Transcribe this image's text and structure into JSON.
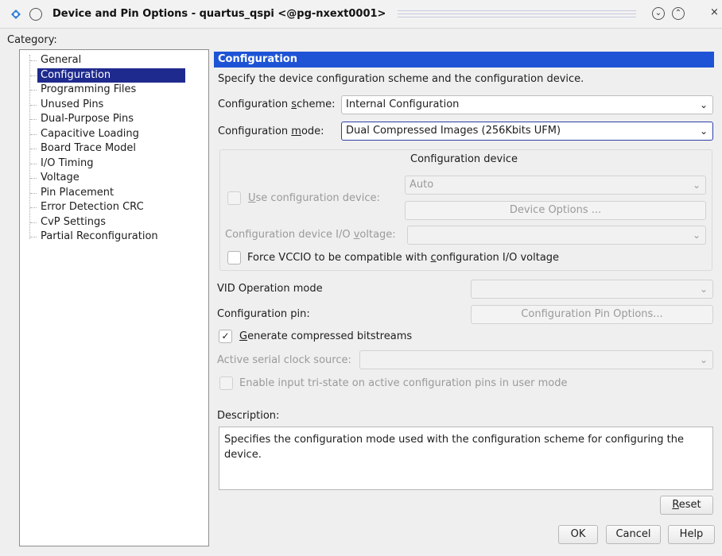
{
  "window": {
    "title": "Device and Pin Options - quartus_qspi <@pg-nxext0001>",
    "controls": [
      "minimize-icon",
      "maximize-icon",
      "close-icon"
    ]
  },
  "category": {
    "label": "Category:",
    "items": [
      {
        "label": "General",
        "selected": false
      },
      {
        "label": "Configuration",
        "selected": true
      },
      {
        "label": "Programming Files",
        "selected": false
      },
      {
        "label": "Unused Pins",
        "selected": false
      },
      {
        "label": "Dual-Purpose Pins",
        "selected": false
      },
      {
        "label": "Capacitive Loading",
        "selected": false
      },
      {
        "label": "Board Trace Model",
        "selected": false
      },
      {
        "label": "I/O Timing",
        "selected": false
      },
      {
        "label": "Voltage",
        "selected": false
      },
      {
        "label": "Pin Placement",
        "selected": false
      },
      {
        "label": "Error Detection CRC",
        "selected": false
      },
      {
        "label": "CvP Settings",
        "selected": false
      },
      {
        "label": "Partial Reconfiguration",
        "selected": false
      }
    ]
  },
  "panel": {
    "header": "Configuration",
    "intro": "Specify the device configuration scheme and the configuration device.",
    "scheme_label_pre": "Configuration ",
    "scheme_label_u": "s",
    "scheme_label_post": "cheme:",
    "scheme_value": "Internal Configuration",
    "mode_label_pre": "Configuration ",
    "mode_label_u": "m",
    "mode_label_post": "ode:",
    "mode_value": "Dual Compressed Images (256Kbits UFM)",
    "device_group_title": "Configuration device",
    "use_device_u": "U",
    "use_device_post": "se configuration device:",
    "device_value": "Auto",
    "device_options_btn": "Device Options ...",
    "io_voltage_pre": "Configuration device I/O ",
    "io_voltage_u": "v",
    "io_voltage_post": "oltage:",
    "force_vccio_pre": "Force VCCIO to be compatible with ",
    "force_vccio_u": "c",
    "force_vccio_post": "onfiguration I/O voltage",
    "vid_label": "VID Operation mode",
    "config_pin_label": "Configuration pin:",
    "config_pin_btn": "Configuration Pin Options...",
    "gen_compressed_u": "G",
    "gen_compressed_post": "enerate compressed bitstreams",
    "gen_compressed_checked": true,
    "active_clock_label": "Active serial clock source:",
    "enable_tristate_label": "Enable input tri-state on active configuration pins in user mode",
    "description_label": "Description:",
    "description_text": "Specifies the configuration mode used with the configuration scheme for configuring the device.",
    "reset_btn_u": "R",
    "reset_btn_post": "eset"
  },
  "footer": {
    "ok": "OK",
    "cancel": "Cancel",
    "help": "Help"
  },
  "colors": {
    "header_blue": "#1e53d6",
    "selection_blue": "#1f2a8e"
  }
}
